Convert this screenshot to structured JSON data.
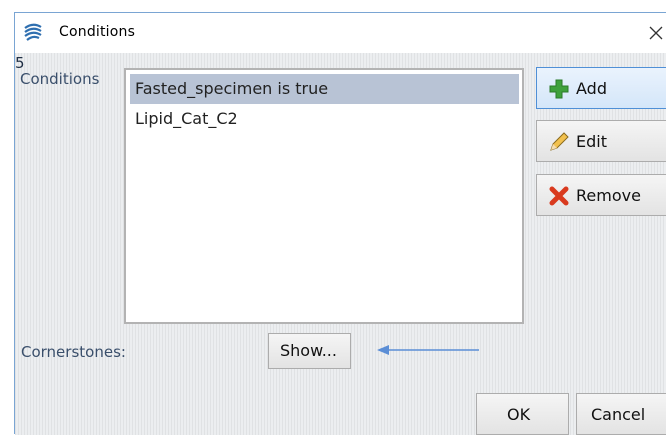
{
  "window": {
    "title": "Conditions",
    "close_glyph": "✕"
  },
  "conditions": {
    "label": "Conditions",
    "items": [
      {
        "label": "Fasted_specimen is true",
        "selected": true
      },
      {
        "label": "Lipid_Cat_C2",
        "selected": false
      }
    ]
  },
  "buttons": {
    "add": {
      "label": "Add",
      "icon": "plus-icon",
      "color": "#3fa13c"
    },
    "edit": {
      "label": "Edit",
      "icon": "pencil-icon"
    },
    "remove": {
      "label": "Remove",
      "icon": "x-icon",
      "color": "#d93a1e"
    },
    "show": {
      "label": "Show..."
    },
    "ok": {
      "label": "OK"
    },
    "cancel": {
      "label": "Cancel"
    }
  },
  "cornerstones": {
    "label": "Cornerstones:",
    "value": "5"
  },
  "annotation": {
    "arrow_color": "#5b8ed6"
  }
}
